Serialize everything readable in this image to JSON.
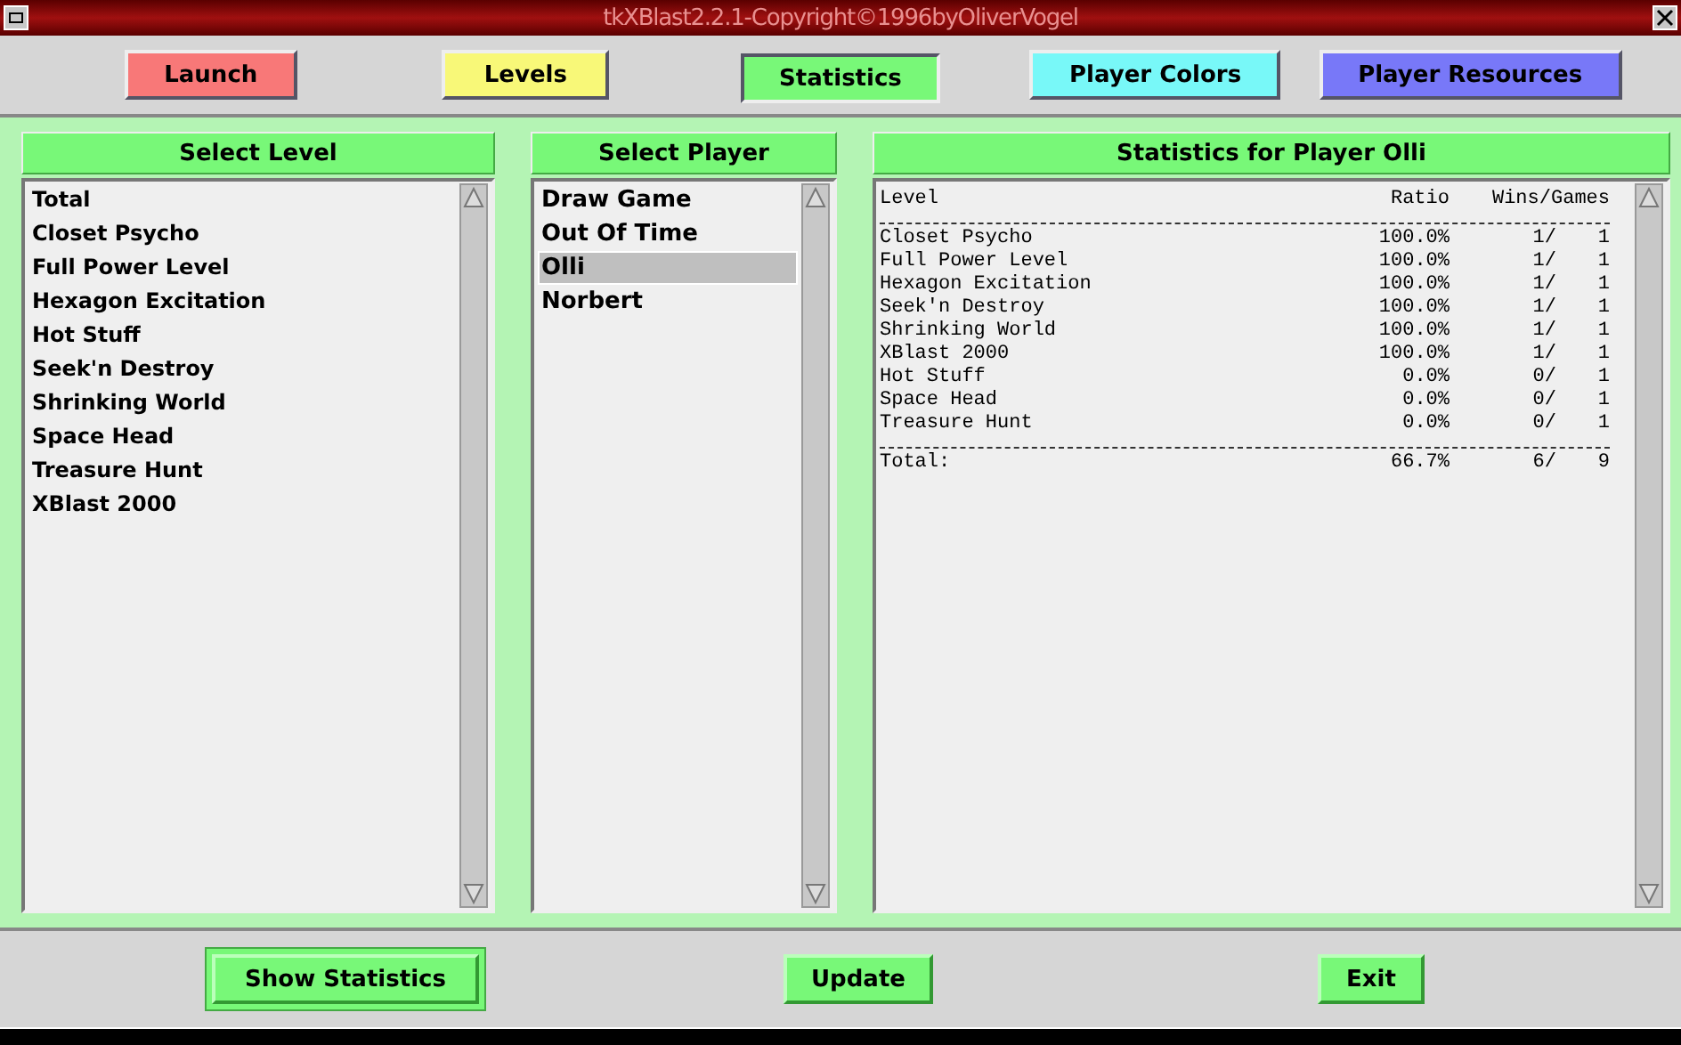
{
  "window": {
    "title": "tkXBlast2.2.1-Copyright©1996byOliverVogel"
  },
  "tabs": [
    {
      "label": "Launch",
      "color": "#f87878",
      "selected": false
    },
    {
      "label": "Levels",
      "color": "#f8f878",
      "selected": false
    },
    {
      "label": "Statistics",
      "color": "#78f878",
      "selected": true
    },
    {
      "label": "Player Colors",
      "color": "#78f8f8",
      "selected": false
    },
    {
      "label": "Player Resources",
      "color": "#7878f8",
      "selected": false
    }
  ],
  "level_list": {
    "title": "Select Level",
    "items": [
      {
        "label": "Total",
        "selected": false
      },
      {
        "label": "Closet Psycho",
        "selected": false
      },
      {
        "label": "Full Power Level",
        "selected": false
      },
      {
        "label": "Hexagon Excitation",
        "selected": false
      },
      {
        "label": "Hot Stuff",
        "selected": false
      },
      {
        "label": "Seek'n Destroy",
        "selected": false
      },
      {
        "label": "Shrinking World",
        "selected": false
      },
      {
        "label": "Space Head",
        "selected": false
      },
      {
        "label": "Treasure Hunt",
        "selected": false
      },
      {
        "label": "XBlast 2000",
        "selected": false
      }
    ]
  },
  "player_list": {
    "title": "Select Player",
    "items": [
      {
        "label": "Draw Game",
        "selected": false
      },
      {
        "label": "Out Of Time",
        "selected": false
      },
      {
        "label": "Olli",
        "selected": true
      },
      {
        "label": "Norbert",
        "selected": false
      }
    ]
  },
  "statistics": {
    "title": "Statistics for Player Olli",
    "columns": [
      "Level",
      "Ratio",
      "Wins/Games"
    ],
    "rows": [
      [
        "Closet Psycho",
        "100.0%",
        "1/",
        "1"
      ],
      [
        "Full Power Level",
        "100.0%",
        "1/",
        "1"
      ],
      [
        "Hexagon Excitation",
        "100.0%",
        "1/",
        "1"
      ],
      [
        "Seek'n Destroy",
        "100.0%",
        "1/",
        "1"
      ],
      [
        "Shrinking World",
        "100.0%",
        "1/",
        "1"
      ],
      [
        "XBlast 2000",
        "100.0%",
        "1/",
        "1"
      ],
      [
        "Hot Stuff",
        "0.0%",
        "0/",
        "1"
      ],
      [
        "Space Head",
        "0.0%",
        "0/",
        "1"
      ],
      [
        "Treasure Hunt",
        "0.0%",
        "0/",
        "1"
      ]
    ],
    "total": [
      "Total:",
      "66.7%",
      "6/",
      "9"
    ]
  },
  "buttons": [
    {
      "label": "Show Statistics",
      "default": true
    },
    {
      "label": "Update",
      "default": false
    },
    {
      "label": "Exit",
      "default": false
    }
  ]
}
